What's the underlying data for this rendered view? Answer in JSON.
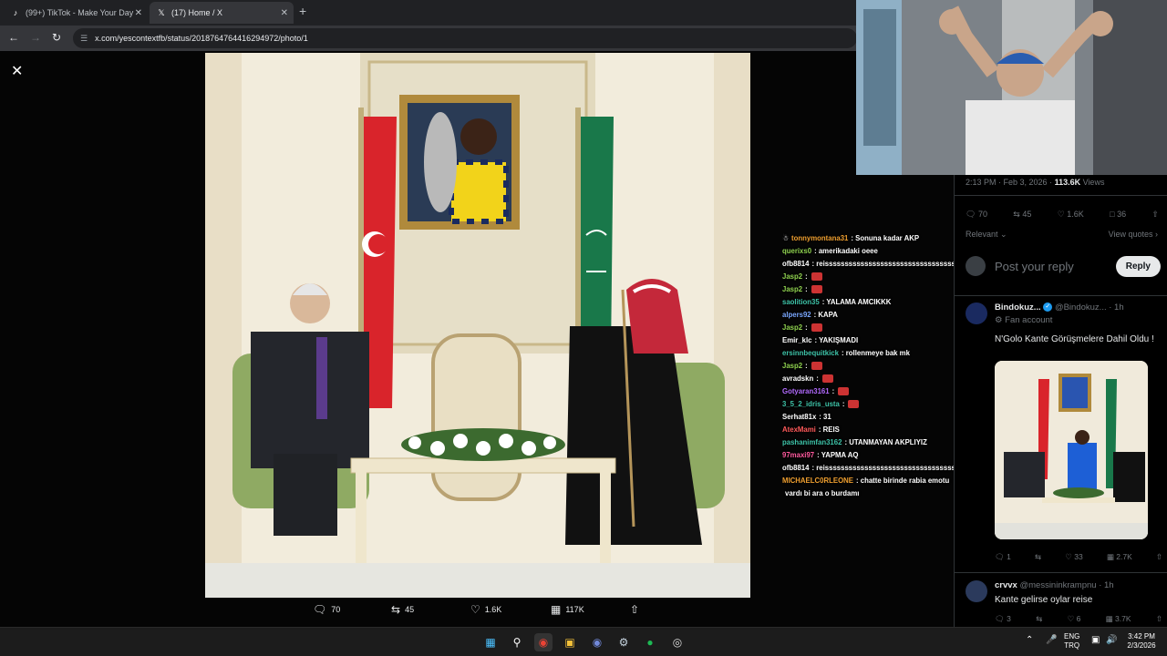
{
  "browser": {
    "tabs": [
      {
        "title": "(99+) TikTok - Make Your Day",
        "icon": "tiktok-icon"
      },
      {
        "title": "(17) Home / X",
        "icon": "x-logo-icon"
      }
    ],
    "url": "x.com/yescontextfb/status/2018764764416294972/photo/1"
  },
  "viewer": {
    "stats": {
      "replies": "70",
      "reposts": "45",
      "likes": "1.6K",
      "views": "117K"
    }
  },
  "chat": [
    {
      "user": "tonnymontana31",
      "color": "#f0a030",
      "msg": ": Sonuna kadar AKP",
      "prefix": "☃"
    },
    {
      "user": "querixs0",
      "color": "#8fd14f",
      "msg": ": amerikadaki oeee"
    },
    {
      "user": "ofb8814",
      "color": "#ffffff",
      "msg": ": reisssssssssssssssssssssssssssssssssssss"
    },
    {
      "user": "Jasp2",
      "color": "#8fd14f",
      "msg": ":",
      "emote": true
    },
    {
      "user": "Jasp2",
      "color": "#8fd14f",
      "msg": ":",
      "emote": true
    },
    {
      "user": "saolition35",
      "color": "#3ec3a8",
      "msg": ": YALAMA AMCIKKK"
    },
    {
      "user": "alpers92",
      "color": "#7aa7ff",
      "msg": ": KAPA"
    },
    {
      "user": "Jasp2",
      "color": "#8fd14f",
      "msg": ":",
      "emote": true
    },
    {
      "user": "Emir_klc",
      "color": "#ffffff",
      "msg": ": YAKIŞMADI"
    },
    {
      "user": "ersinnbequitkick",
      "color": "#3ec3a8",
      "msg": ": rollenmeye bak mk"
    },
    {
      "user": "Jasp2",
      "color": "#8fd14f",
      "msg": ":",
      "emote": true
    },
    {
      "user": "avradskn",
      "color": "#ffffff",
      "msg": ":",
      "emote": true
    },
    {
      "user": "Gotyaran3161",
      "color": "#b36bff",
      "msg": ":",
      "emote": true
    },
    {
      "user": "3_5_2_idris_usta",
      "color": "#3ec3a8",
      "msg": ":",
      "emote": true
    },
    {
      "user": "Serhat81x",
      "color": "#ffffff",
      "msg": ": 31"
    },
    {
      "user": "AtexMami",
      "color": "#ff5a5a",
      "msg": ": REIS"
    },
    {
      "user": "pashanimfan3162",
      "color": "#3ec3a8",
      "msg": ": UTANMAYAN AKPLIYIZ"
    },
    {
      "user": "97maxi97",
      "color": "#ff5a9e",
      "msg": ": YAPMA AQ"
    },
    {
      "user": "ofb8814",
      "color": "#ffffff",
      "msg": ": reisssssssssssssssssssssssssssssssss"
    },
    {
      "user": "MICHAELC0RLEONE",
      "color": "#f0a030",
      "msg": ": chatte birinde rabia emotu"
    },
    {
      "user": "",
      "color": "#ffffff",
      "msg": "vardı bi ara o burdamı"
    }
  ],
  "sidebar": {
    "meta_time": "2:13 PM · Feb 3, 2026 · ",
    "meta_views": "113.6K",
    "meta_views_label": " Views",
    "actions": {
      "replies": "70",
      "reposts": "45",
      "likes": "1.6K",
      "bookmarks": "36"
    },
    "relevant": "Relevant",
    "view_quotes": "View quotes",
    "reply_placeholder": "Post your reply",
    "reply_button": "Reply",
    "posts": [
      {
        "name": "Bindokuz...",
        "handle": "@Bindokuz...",
        "time": "· 1h",
        "sub": "Fan account",
        "text": "N'Golo Kante Görüşmelere Dahil Oldu !",
        "acts": {
          "replies": "1",
          "reposts": "",
          "likes": "33",
          "views": "2.7K"
        }
      },
      {
        "name": "crvvx",
        "handle": "@messininkrampnu",
        "time": "· 1h",
        "text": "Kante gelirse oylar reise",
        "acts": {
          "replies": "3",
          "reposts": "",
          "likes": "6",
          "views": "3.7K"
        }
      }
    ]
  },
  "taskbar": {
    "lang1": "ENG",
    "lang2": "TRQ",
    "time": "3:42 PM",
    "date": "2/3/2026"
  }
}
